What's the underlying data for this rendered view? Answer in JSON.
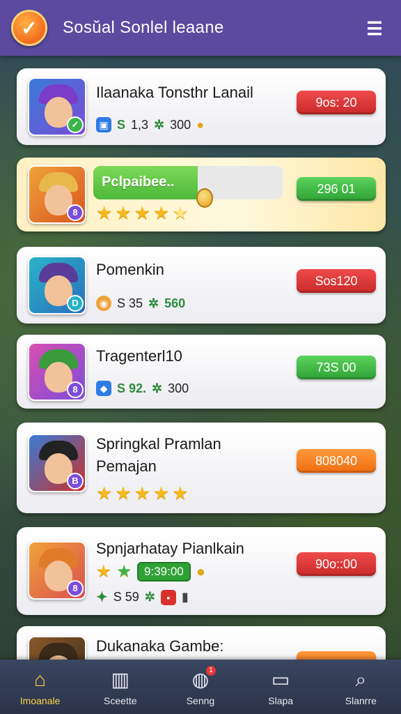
{
  "header": {
    "title": "Sosŭal Sonlel leaane",
    "logo_icon": "check-icon",
    "menu_icon": "menu-icon"
  },
  "cards": [
    {
      "title": "Ilaanaka Tonsthr Lanail",
      "meta": [
        "1,3",
        "300"
      ],
      "pill": "9os: 20",
      "pill_color": "red",
      "badge": "✓"
    },
    {
      "title": "Pclpaibee..",
      "progress": 0.55,
      "stars_filled": 4,
      "pill": "296 01",
      "pill_color": "green",
      "badge": "8"
    },
    {
      "title": "Pomenkin",
      "meta": [
        "S 35",
        "560"
      ],
      "pill": "Sos120",
      "pill_color": "red",
      "badge": "D"
    },
    {
      "title": "Tragenterl10",
      "meta": [
        "S 92.",
        "300"
      ],
      "pill": "73S 00",
      "pill_color": "green",
      "badge": "8"
    },
    {
      "title": "Springkal Pramlan",
      "subtitle": "Pemajan",
      "stars_filled": 5,
      "pill": "808040",
      "pill_color": "orange",
      "badge": "B"
    },
    {
      "title": "Spnjarhatay Pianlkain",
      "score_chip": "9:39:00",
      "meta": [
        "S 59"
      ],
      "pill": "90o::00",
      "pill_color": "red",
      "badge": "8"
    },
    {
      "title": "Dukanaka Gambe:",
      "pill_color": "orange"
    }
  ],
  "nav": [
    {
      "label": "Imoanale",
      "icon": "home-icon",
      "active": true
    },
    {
      "label": "Sceette",
      "icon": "store-icon"
    },
    {
      "label": "Senng",
      "icon": "chest-icon",
      "badge": "1"
    },
    {
      "label": "Slapa",
      "icon": "laptop-icon"
    },
    {
      "label": "Slanrre",
      "icon": "search-icon"
    }
  ]
}
